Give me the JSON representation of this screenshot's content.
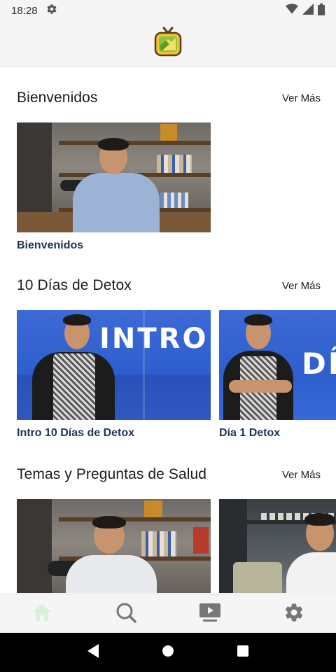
{
  "status_bar": {
    "time": "18:28",
    "icons": [
      "gear-icon",
      "wifi-icon",
      "signal-icon",
      "battery-icon"
    ]
  },
  "app": {
    "logo": "tv-logo-icon",
    "brand_colors": {
      "green": "#8cc43f",
      "yellow": "#f2c230",
      "brown": "#5a3b21"
    }
  },
  "sections": [
    {
      "title": "Bienvenidos",
      "see_more": "Ver Más",
      "videos": [
        {
          "title": "Bienvenidos"
        }
      ]
    },
    {
      "title": "10 Días de Detox",
      "see_more": "Ver Más",
      "videos": [
        {
          "title": "Intro 10 Días de Detox",
          "thumb_text": "INTRO"
        },
        {
          "title": "Día 1 Detox",
          "thumb_text": "DÍ"
        }
      ]
    },
    {
      "title": "Temas y Preguntas de Salud",
      "see_more": "Ver Más",
      "videos": [
        {
          "title": ""
        },
        {
          "title": ""
        }
      ]
    }
  ],
  "bottom_nav": {
    "items": [
      {
        "name": "home",
        "icon": "home-icon",
        "active": true
      },
      {
        "name": "search",
        "icon": "search-icon",
        "active": false
      },
      {
        "name": "videos",
        "icon": "video-play-icon",
        "active": false
      },
      {
        "name": "settings",
        "icon": "gear-icon",
        "active": false
      }
    ],
    "active_color": "#d9f0d9",
    "inactive_color": "#777777"
  },
  "system_nav": {
    "icons": [
      "back-icon",
      "home-circle-icon",
      "recents-icon"
    ]
  }
}
